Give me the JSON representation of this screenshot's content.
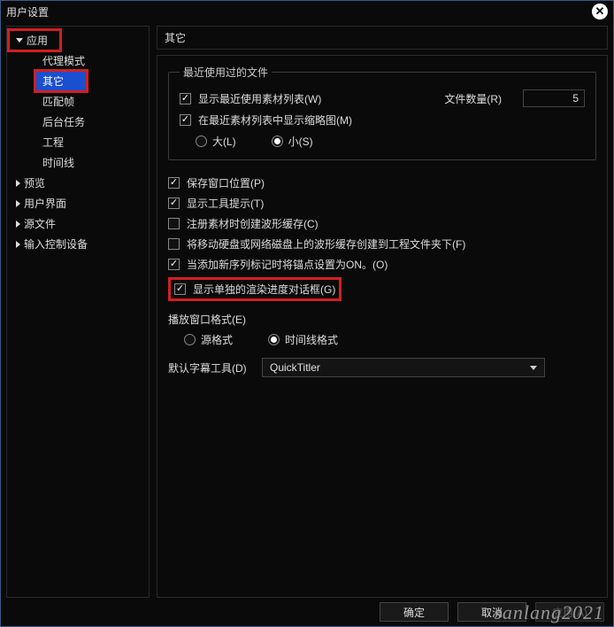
{
  "window": {
    "title": "用户设置"
  },
  "sidebar": {
    "items": [
      {
        "label": "应用",
        "expanded": true,
        "children": [
          {
            "label": "代理模式"
          },
          {
            "label": "其它",
            "selected": true
          },
          {
            "label": "匹配帧"
          },
          {
            "label": "后台任务"
          },
          {
            "label": "工程"
          },
          {
            "label": "时间线"
          }
        ]
      },
      {
        "label": "预览",
        "expanded": false
      },
      {
        "label": "用户界面",
        "expanded": false
      },
      {
        "label": "源文件",
        "expanded": false
      },
      {
        "label": "输入控制设备",
        "expanded": false
      }
    ]
  },
  "main": {
    "heading": "其它",
    "recent_group": {
      "legend": "最近使用过的文件",
      "show_recent_list": {
        "label": "显示最近使用素材列表(W)",
        "checked": true
      },
      "file_count_label": "文件数量(R)",
      "file_count_value": "5",
      "show_thumbnails": {
        "label": "在最近素材列表中显示缩略图(M)",
        "checked": true
      },
      "size_large": "大(L)",
      "size_small": "小(S)",
      "size_selected": "small"
    },
    "options": {
      "save_window_pos": {
        "label": "保存窗口位置(P)",
        "checked": true
      },
      "show_tooltips": {
        "label": "显示工具提示(T)",
        "checked": true
      },
      "create_waveform": {
        "label": "注册素材时创建波形缓存(C)",
        "checked": false
      },
      "move_waveform": {
        "label": "将移动硬盘或网络磁盘上的波形缓存创建到工程文件夹下(F)",
        "checked": false
      },
      "anchor_on": {
        "label": "当添加新序列标记时将锚点设置为ON。(O)",
        "checked": true
      },
      "show_render_dialog": {
        "label": "显示单独的渲染进度对话框(G)",
        "checked": true
      }
    },
    "playback_format": {
      "label": "播放窗口格式(E)",
      "source": "源格式",
      "timeline": "时间线格式",
      "selected": "timeline"
    },
    "default_titler": {
      "label": "默认字幕工具(D)",
      "value": "QuickTitler"
    }
  },
  "footer": {
    "ok": "确定",
    "cancel": "取消",
    "apply": "应用(A)"
  },
  "watermark": "sanlang2021"
}
